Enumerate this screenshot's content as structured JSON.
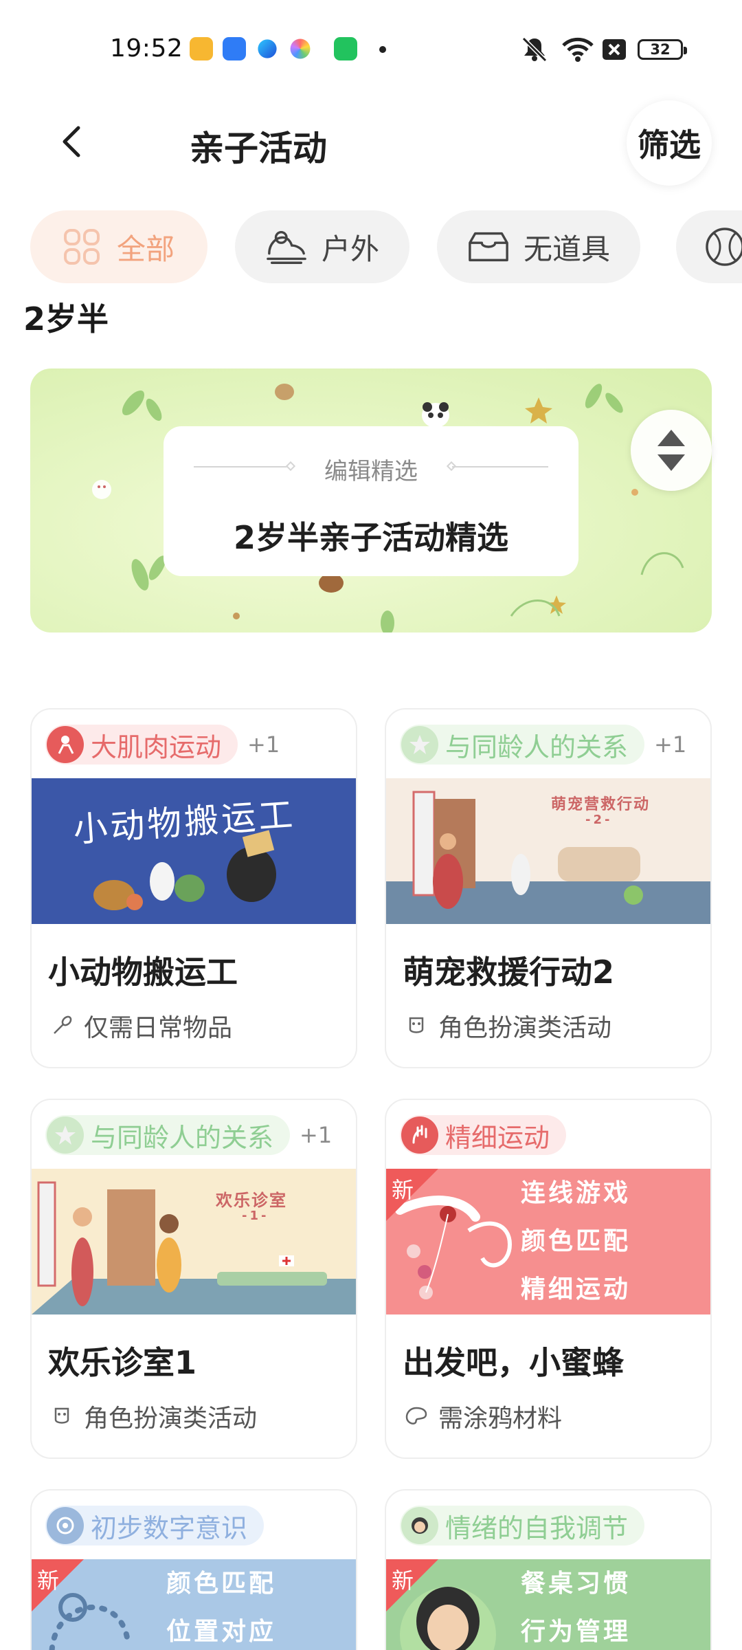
{
  "status_bar": {
    "time": "19:52",
    "battery": "32",
    "icons": [
      "app-book-icon",
      "app-briefcase-icon",
      "app-feather-icon",
      "app-palette-icon",
      "app-wechat-icon",
      "mute-icon",
      "wifi-icon",
      "sim-x-icon"
    ]
  },
  "header": {
    "title": "亲子活动",
    "filter_label": "筛选"
  },
  "tabs": [
    {
      "label": "全部",
      "icon": "grid-icon",
      "active": true
    },
    {
      "label": "户外",
      "icon": "outdoor-icon",
      "active": false
    },
    {
      "label": "无道具",
      "icon": "box-icon",
      "active": false
    }
  ],
  "age_heading": "2岁半",
  "banner": {
    "subtitle": "编辑精选",
    "title": "2岁半亲子活动精选"
  },
  "cards": [
    {
      "tag": "大肌肉运动",
      "tag_color": "red",
      "extra": "+1",
      "title": "小动物搬运工",
      "meta": "仅需日常物品",
      "meta_icon": "spoon-icon",
      "image_text": "小动物搬运工",
      "is_new": false
    },
    {
      "tag": "与同龄人的关系",
      "tag_color": "green",
      "extra": "+1",
      "title": "萌宠救援行动2",
      "meta": "角色扮演类活动",
      "meta_icon": "mask-icon",
      "image_text": "萌宠营救行动",
      "image_sub": "-2-",
      "is_new": false
    },
    {
      "tag": "与同龄人的关系",
      "tag_color": "green",
      "extra": "+1",
      "title": "欢乐诊室1",
      "meta": "角色扮演类活动",
      "meta_icon": "mask-icon",
      "image_text": "欢乐诊室",
      "image_sub": "-1-",
      "is_new": false
    },
    {
      "tag": "精细运动",
      "tag_color": "red",
      "extra": "",
      "title": "出发吧，小蜜蜂",
      "meta": "需涂鸦材料",
      "meta_icon": "palette-icon",
      "image_lines": [
        "连线游戏",
        "颜色匹配",
        "精细运动"
      ],
      "is_new": true,
      "new_label": "新"
    },
    {
      "tag": "初步数字意识",
      "tag_color": "blue",
      "extra": "",
      "image_lines": [
        "颜色匹配",
        "位置对应"
      ],
      "is_new": true,
      "new_label": "新"
    },
    {
      "tag": "情绪的自我调节",
      "tag_color": "green",
      "extra": "",
      "image_lines": [
        "餐桌习惯",
        "行为管理"
      ],
      "is_new": true,
      "new_label": "新"
    }
  ],
  "colors": {
    "accent": "#f2a37e",
    "tag_red": "#e66b6b",
    "tag_green": "#8fce93",
    "tag_blue": "#8fb0df",
    "new_badge": "#ef5a5a"
  }
}
